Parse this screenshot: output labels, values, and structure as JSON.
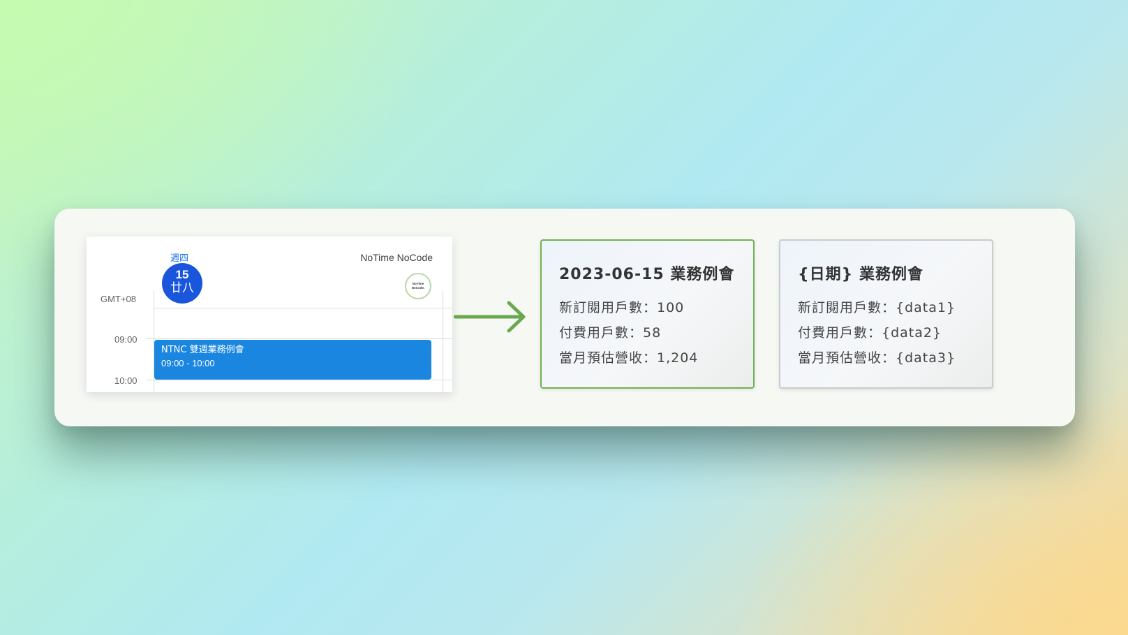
{
  "calendar": {
    "weekday": "週四",
    "date_number": "15",
    "lunar_date": "廿八",
    "owner": "NoTime NoCode",
    "timezone": "GMT+08",
    "hours": [
      "09:00",
      "10:00"
    ],
    "event": {
      "title": "NTNC 雙週業務例會",
      "time": "09:00 - 10:00",
      "color": "#1a86e0"
    },
    "logo_text": [
      "NoTime",
      "NoCode."
    ]
  },
  "arrow": {
    "color": "#6aa84f",
    "icon": "right-arrow-icon"
  },
  "filled_card": {
    "title": "2023-06-15 業務例會",
    "lines": [
      "新訂閱用戶數：100",
      "付費用戶數：58",
      "當月預估營收：1,204"
    ],
    "border_color": "#72b152"
  },
  "template_card": {
    "title": "{日期} 業務例會",
    "lines": [
      "新訂閱用戶數：{data1}",
      "付費用戶數：{data2}",
      "當月預估營收：{data3}"
    ],
    "border_color": "#c9cccf"
  }
}
